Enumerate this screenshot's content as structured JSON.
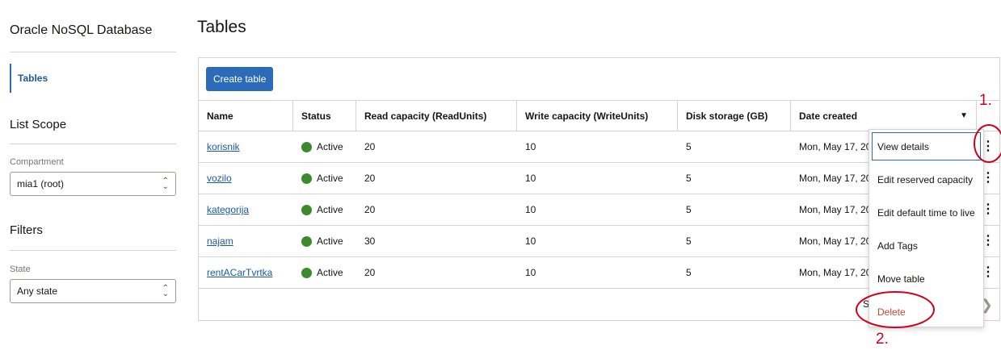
{
  "sidebar": {
    "title": "Oracle NoSQL Database",
    "nav_item": "Tables",
    "list_scope_heading": "List Scope",
    "compartment_label": "Compartment",
    "compartment_value": "mia1 (root)",
    "filters_heading": "Filters",
    "state_label": "State",
    "state_value": "Any state"
  },
  "page": {
    "title": "Tables",
    "create_button": "Create table"
  },
  "table": {
    "headers": {
      "name": "Name",
      "status": "Status",
      "read": "Read capacity (ReadUnits)",
      "write": "Write capacity (WriteUnits)",
      "disk": "Disk storage (GB)",
      "date": "Date created"
    },
    "rows": [
      {
        "name": "korisnik",
        "status": "Active",
        "read": "20",
        "write": "10",
        "disk": "5",
        "date": "Mon, May 17, 20"
      },
      {
        "name": "vozilo",
        "status": "Active",
        "read": "20",
        "write": "10",
        "disk": "5",
        "date": "Mon, May 17, 20"
      },
      {
        "name": "kategorija",
        "status": "Active",
        "read": "20",
        "write": "10",
        "disk": "5",
        "date": "Mon, May 17, 20"
      },
      {
        "name": "najam",
        "status": "Active",
        "read": "30",
        "write": "10",
        "disk": "5",
        "date": "Mon, May 17, 20"
      },
      {
        "name": "rentACarTvrtka",
        "status": "Active",
        "read": "20",
        "write": "10",
        "disk": "5",
        "date": "Mon, May 17, 20"
      }
    ],
    "footer_text": "S"
  },
  "menu": {
    "items": [
      "View details",
      "Edit reserved capacity",
      "Edit default time to live",
      "Add Tags",
      "Move table",
      "Delete"
    ]
  },
  "annotations": {
    "step1": "1.",
    "step2": "2."
  },
  "colors": {
    "accent": "#2c6bb8",
    "active_status": "#3b8a2e",
    "danger": "#c74634",
    "annotation": "#d0021b"
  }
}
